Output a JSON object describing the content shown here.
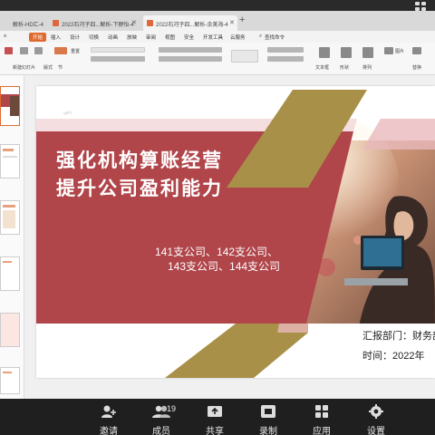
{
  "tabs": [
    {
      "label": "解析-HD汇-4"
    },
    {
      "label": "2022石河子四...解析-下野怡-4"
    },
    {
      "label": "2022石河子四...解析-余美海-4"
    }
  ],
  "menu": [
    "开始",
    "插入",
    "设计",
    "切换",
    "动画",
    "放映",
    "审阅",
    "视图",
    "安全",
    "开发工具",
    "云服务",
    "查找命令"
  ],
  "ribbon": {
    "labels": [
      "新建幻灯片",
      "版式",
      "节",
      "重置",
      "文本框",
      "形状",
      "排列",
      "图片",
      "替换"
    ]
  },
  "slide": {
    "title_line1": "强化机构算账经营",
    "title_line2": "提升公司盈利能力",
    "subtitle_line1": "141支公司、142支公司、",
    "subtitle_line2": "143支公司、144支公司",
    "reporter": "汇报部门：财务部",
    "date": "时间：2022年"
  },
  "bottom_bar": {
    "invite": "邀请",
    "members": "成员",
    "members_count": "19",
    "share": "共享",
    "record": "录制",
    "apps": "应用",
    "settings": "设置"
  },
  "colors": {
    "accent": "#e06a2e",
    "banner": "#b0454a",
    "gold": "#a89048",
    "pink": "#e8b9bb"
  }
}
